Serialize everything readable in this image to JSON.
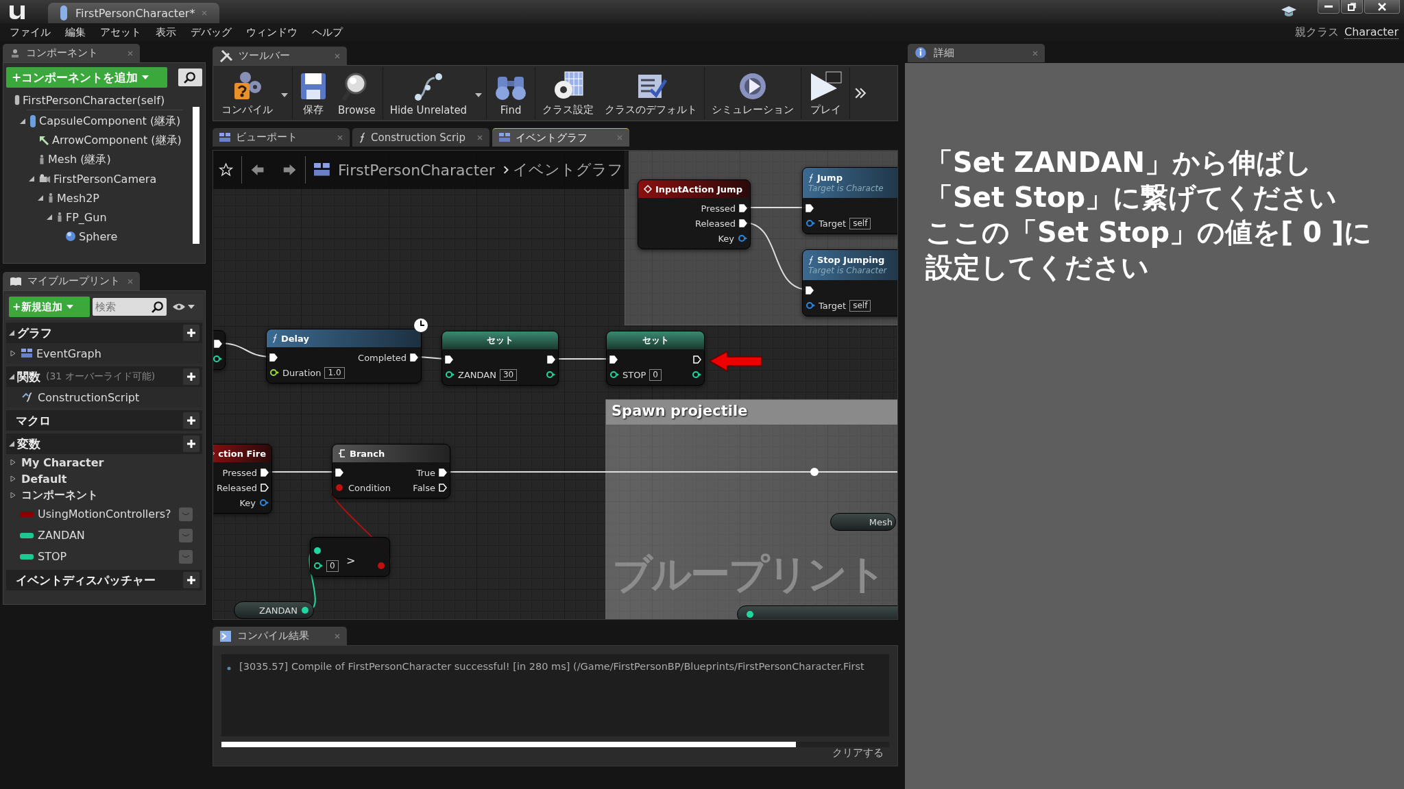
{
  "window": {
    "tab_title": "FirstPersonCharacter*"
  },
  "menu": [
    "ファイル",
    "編集",
    "アセット",
    "表示",
    "デバッグ",
    "ウィンドウ",
    "ヘルプ"
  ],
  "parent_class": {
    "label": "親クラス",
    "value": "Character"
  },
  "components": {
    "tab": "コンポーネント",
    "add_button": "+コンポーネントを追加",
    "tree": [
      {
        "kind": "self",
        "label": "FirstPersonCharacter(self)"
      },
      {
        "kind": "capsule",
        "label": "CapsuleComponent (継承)",
        "expanded": true,
        "children": [
          {
            "kind": "arrow",
            "label": "ArrowComponent (継承)"
          },
          {
            "kind": "mesh",
            "label": "Mesh (継承)"
          },
          {
            "kind": "camera",
            "label": "FirstPersonCamera",
            "expanded": true,
            "children": [
              {
                "kind": "mesh",
                "label": "Mesh2P",
                "expanded": true,
                "children": [
                  {
                    "kind": "mesh",
                    "label": "FP_Gun",
                    "expanded": true,
                    "children": [
                      {
                        "kind": "sphere",
                        "label": "Sphere"
                      }
                    ]
                  }
                ]
              }
            ]
          }
        ]
      }
    ]
  },
  "my_blueprint": {
    "tab": "マイブループリント",
    "add_button": "+新規追加",
    "search": {
      "placeholder": "検索"
    },
    "sections": [
      {
        "title": "グラフ",
        "expanded": true,
        "items": [
          {
            "kind": "graph",
            "label": "EventGraph",
            "expanded": false
          }
        ]
      },
      {
        "title": "関数",
        "note": "(31 オーバーライド可能)",
        "expanded": true,
        "items": [
          {
            "kind": "function",
            "label": "ConstructionScript"
          }
        ]
      },
      {
        "title": "マクロ"
      },
      {
        "title": "変数",
        "expanded": true,
        "items": [
          {
            "kind": "category",
            "label": "My Character",
            "expanded": false
          },
          {
            "kind": "category",
            "label": "Default",
            "expanded": false
          },
          {
            "kind": "category",
            "label": "コンポーネント",
            "expanded": false
          },
          {
            "kind": "variable",
            "label": "UsingMotionControllers?",
            "color": "#8b0000"
          },
          {
            "kind": "variable",
            "label": "ZANDAN",
            "color": "#1fc890"
          },
          {
            "kind": "variable",
            "label": "STOP",
            "color": "#1fc890"
          }
        ]
      },
      {
        "title": "イベントディスパッチャー"
      }
    ]
  },
  "toolbar": {
    "tab": "ツールバー",
    "groups": [
      [
        {
          "kind": "compile",
          "label": "コンパイル",
          "dropdown": true
        }
      ],
      [
        {
          "kind": "save",
          "label": "保存"
        },
        {
          "kind": "browse",
          "label": "Browse"
        }
      ],
      [
        {
          "kind": "hide",
          "label": "Hide Unrelated",
          "dropdown": true
        }
      ],
      [
        {
          "kind": "find",
          "label": "Find"
        }
      ],
      [
        {
          "kind": "settings",
          "label": "クラス設定"
        },
        {
          "kind": "defaults",
          "label": "クラスのデフォルト"
        }
      ],
      [
        {
          "kind": "simulate",
          "label": "シミュレーション"
        }
      ],
      [
        {
          "kind": "play",
          "label": "プレイ"
        }
      ]
    ]
  },
  "document_tabs": [
    {
      "kind": "viewport",
      "label": "ビューポート",
      "selected": false
    },
    {
      "kind": "function",
      "label": "Construction Scrip",
      "selected": false
    },
    {
      "kind": "graph",
      "label": "イベントグラフ",
      "selected": true
    }
  ],
  "breadcrumb": [
    "FirstPersonCharacter",
    "イベントグラフ"
  ],
  "graph": {
    "watermark": "ブループリント",
    "comments": [
      {
        "kind": "untitled"
      },
      {
        "kind": "titled",
        "title": "Spawn projectile"
      }
    ],
    "nodes": [
      {
        "kind": "stub",
        "rows": [
          {
            "right": {
              "kind": "exec",
              "connected": true
            }
          },
          {
            "right": {
              "kind": "int",
              "connected": false
            }
          }
        ]
      },
      {
        "kind": "function",
        "title": "Delay",
        "latent": true,
        "rows": [
          {
            "left": {
              "kind": "exec",
              "connected": true
            },
            "right": {
              "kind": "exec",
              "label": "Completed",
              "connected": true
            }
          },
          {
            "left": {
              "kind": "float",
              "label": "Duration",
              "value": "1.0",
              "connected": false
            }
          }
        ]
      },
      {
        "kind": "set",
        "title": "セット",
        "rows": [
          {
            "left": {
              "kind": "exec",
              "connected": true
            },
            "right": {
              "kind": "exec",
              "connected": true
            }
          },
          {
            "left": {
              "kind": "int",
              "label": "ZANDAN",
              "value": "30",
              "connected": false
            },
            "right": {
              "kind": "int",
              "connected": false
            }
          }
        ]
      },
      {
        "kind": "set",
        "title": "セット",
        "rows": [
          {
            "left": {
              "kind": "exec",
              "connected": true
            },
            "right": {
              "kind": "exec",
              "connected": false
            }
          },
          {
            "left": {
              "kind": "int",
              "label": "STOP",
              "value": "0",
              "connected": false
            },
            "right": {
              "kind": "int",
              "connected": false
            }
          }
        ]
      },
      {
        "kind": "event",
        "title": "InputAction Jump",
        "rows": [
          {
            "right": {
              "kind": "exec",
              "label": "Pressed",
              "connected": true
            }
          },
          {
            "right": {
              "kind": "exec",
              "label": "Released",
              "connected": true
            }
          },
          {
            "right": {
              "kind": "key",
              "label": "Key",
              "connected": false
            }
          }
        ]
      },
      {
        "kind": "function",
        "title": "Jump",
        "subtitle": "Target is Characte",
        "rows": [
          {
            "left": {
              "kind": "exec",
              "connected": true
            }
          },
          {
            "left": {
              "kind": "object",
              "label": "Target",
              "value": "self",
              "connected": false
            }
          }
        ]
      },
      {
        "kind": "function",
        "title": "Stop Jumping",
        "subtitle": "Target is Character",
        "rows": [
          {
            "left": {
              "kind": "exec",
              "connected": true
            }
          },
          {
            "left": {
              "kind": "object",
              "label": "Target",
              "value": "self",
              "connected": false
            }
          }
        ]
      },
      {
        "kind": "event",
        "title": "ction Fire",
        "rows": [
          {
            "right": {
              "kind": "exec",
              "label": "Pressed",
              "connected": true
            }
          },
          {
            "right": {
              "kind": "exec",
              "label": "Released",
              "connected": false
            }
          },
          {
            "right": {
              "kind": "key",
              "label": "Key",
              "connected": false
            }
          }
        ]
      },
      {
        "kind": "branch",
        "title": "Branch",
        "rows": [
          {
            "left": {
              "kind": "exec",
              "connected": true
            },
            "right": {
              "kind": "exec",
              "label": "True",
              "connected": true
            }
          },
          {
            "left": {
              "kind": "bool",
              "label": "Condition",
              "connected": true
            },
            "right": {
              "kind": "exec",
              "label": "False",
              "connected": false
            }
          }
        ]
      },
      {
        "kind": "compact",
        "symbol": ">",
        "rows": [
          {
            "left": {
              "kind": "int",
              "connected": true
            }
          },
          {
            "left": {
              "kind": "int",
              "value": "0",
              "connected": false
            },
            "right": {
              "kind": "bool",
              "connected": true
            }
          }
        ]
      },
      {
        "kind": "getter",
        "label": "ZANDAN",
        "pin": {
          "kind": "int",
          "connected": true
        }
      },
      {
        "kind": "getter",
        "label": "Mesh"
      },
      {
        "kind": "getter",
        "pin": {
          "kind": "int",
          "connected": true
        }
      }
    ]
  },
  "compiler_results": {
    "tab": "コンパイル結果",
    "messages": [
      "[3035.57] Compile of FirstPersonCharacter successful! [in 280 ms] (/Game/FirstPersonBP/Blueprints/FirstPersonCharacter.First"
    ],
    "clear_button": "クリアする"
  },
  "details": {
    "tab": "詳細"
  },
  "annotation": {
    "lines": [
      "「Set ZANDAN」から伸ばし",
      "「Set Stop」に繋げてください",
      "ここの「Set Stop」の値を[ 0 ]に",
      "設定してください"
    ]
  }
}
